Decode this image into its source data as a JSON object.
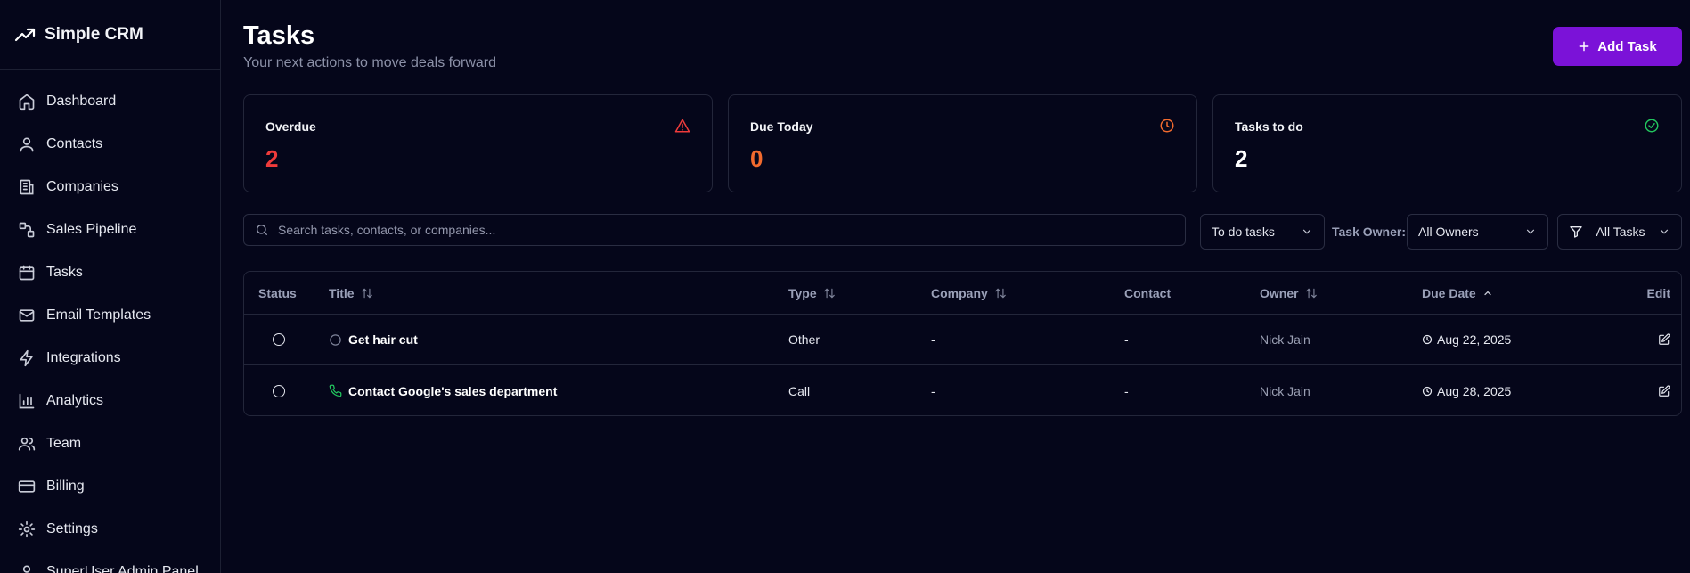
{
  "app": {
    "name": "Simple CRM"
  },
  "sidebar": {
    "items": [
      {
        "label": "Dashboard",
        "icon": "home-icon"
      },
      {
        "label": "Contacts",
        "icon": "user-icon"
      },
      {
        "label": "Companies",
        "icon": "building-icon"
      },
      {
        "label": "Sales Pipeline",
        "icon": "workflow-icon"
      },
      {
        "label": "Tasks",
        "icon": "calendar-icon"
      },
      {
        "label": "Email Templates",
        "icon": "mail-icon"
      },
      {
        "label": "Integrations",
        "icon": "zap-icon"
      },
      {
        "label": "Analytics",
        "icon": "chart-bar-icon"
      },
      {
        "label": "Team",
        "icon": "users-icon"
      },
      {
        "label": "Billing",
        "icon": "credit-card-icon"
      },
      {
        "label": "Settings",
        "icon": "gear-icon"
      },
      {
        "label": "SuperUser Admin Panel",
        "icon": "user-icon"
      }
    ]
  },
  "header": {
    "title": "Tasks",
    "subtitle": "Your next actions to move deals forward",
    "add_label": "Add Task"
  },
  "stats": {
    "overdue": {
      "label": "Overdue",
      "value": "2",
      "color": "#ef3b3b"
    },
    "due_today": {
      "label": "Due Today",
      "value": "0",
      "color": "#f26a2e"
    },
    "todo": {
      "label": "Tasks to do",
      "value": "2",
      "color": "#ffffff"
    }
  },
  "filters": {
    "search_placeholder": "Search tasks, contacts, or companies...",
    "status_select": "To do tasks",
    "owner_label": "Task Owner:",
    "owner_select": "All Owners",
    "task_filter": "All Tasks"
  },
  "table": {
    "headers": {
      "status": "Status",
      "title": "Title",
      "type": "Type",
      "company": "Company",
      "contact": "Contact",
      "owner": "Owner",
      "due": "Due Date",
      "edit": "Edit"
    },
    "rows": [
      {
        "title": "Get hair cut",
        "type": "Other",
        "company": "-",
        "contact": "-",
        "owner": "Nick Jain",
        "due": "Aug 22, 2025",
        "type_icon": "circle-icon"
      },
      {
        "title": "Contact Google's sales department",
        "type": "Call",
        "company": "-",
        "contact": "-",
        "owner": "Nick Jain",
        "due": "Aug 28, 2025",
        "type_icon": "phone-icon"
      }
    ]
  },
  "colors": {
    "accent": "#7b12d8",
    "background": "#05061a",
    "call_green": "#22c55e"
  }
}
